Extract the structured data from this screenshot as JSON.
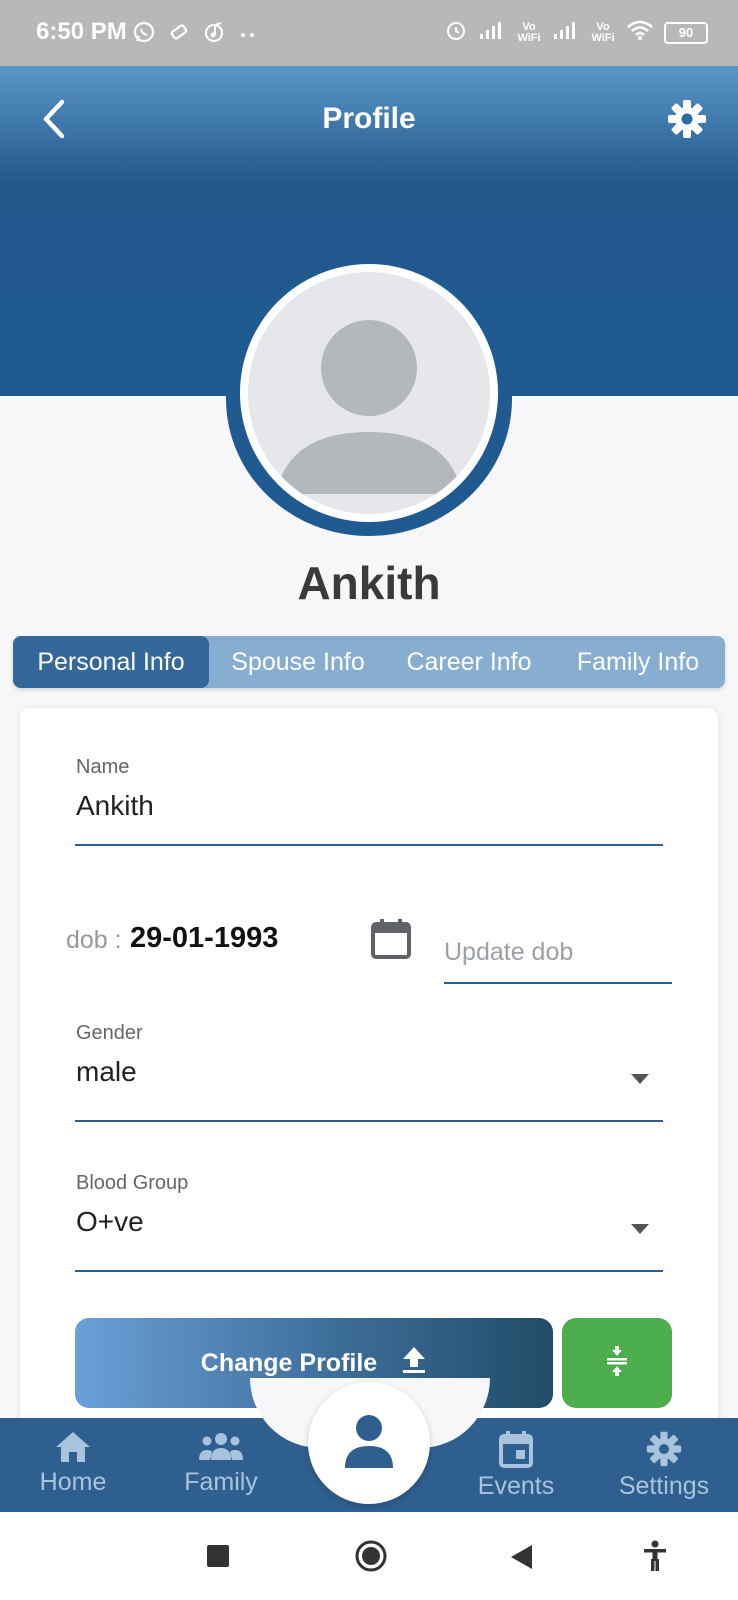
{
  "status_bar": {
    "time": "6:50 PM",
    "battery": "90",
    "vowifi_1": "Vo WiFi",
    "vowifi_2": "Vo WiFi",
    "icons": [
      "whatsapp-icon",
      "tag-icon",
      "music-icon",
      "more-dots-icon",
      "alarm-icon",
      "signal-icon",
      "wifi-icon",
      "battery-icon"
    ]
  },
  "header": {
    "title": "Profile",
    "back_icon": "chevron-left-icon",
    "settings_icon": "gear-icon",
    "gradient_top": "#5b97c8",
    "gradient_bottom": "#1f5a90"
  },
  "profile": {
    "name": "Ankith",
    "avatar_icon": "default-avatar-icon"
  },
  "tabs": [
    {
      "label": "Personal Info",
      "active": true
    },
    {
      "label": "Spouse Info",
      "active": false
    },
    {
      "label": "Career Info",
      "active": false
    },
    {
      "label": "Family Info",
      "active": false
    }
  ],
  "form": {
    "name": {
      "label": "Name",
      "value": "Ankith"
    },
    "dob": {
      "label": "dob :",
      "value": "29-01-1993",
      "update_placeholder": "Update dob",
      "calendar_icon": "calendar-icon"
    },
    "gender": {
      "label": "Gender",
      "value": "male"
    },
    "blood_group": {
      "label": "Blood Group",
      "value": "O+ve"
    }
  },
  "actions": {
    "change_profile_label": "Change Profile",
    "upload_icon": "upload-icon",
    "compress_icon": "compress-icon",
    "compress_color": "#4cae4c"
  },
  "bottom_nav": {
    "items": [
      {
        "label": "Home",
        "icon": "home-icon"
      },
      {
        "label": "Family",
        "icon": "family-icon"
      },
      {
        "label": "",
        "icon": "person-icon"
      },
      {
        "label": "Events",
        "icon": "event-calendar-icon"
      },
      {
        "label": "Settings",
        "icon": "gear-icon"
      }
    ],
    "color": "#2f5f8f"
  },
  "system_nav": {
    "icons": [
      "recents-square-icon",
      "home-circle-icon",
      "back-triangle-icon",
      "accessibility-icon"
    ]
  }
}
